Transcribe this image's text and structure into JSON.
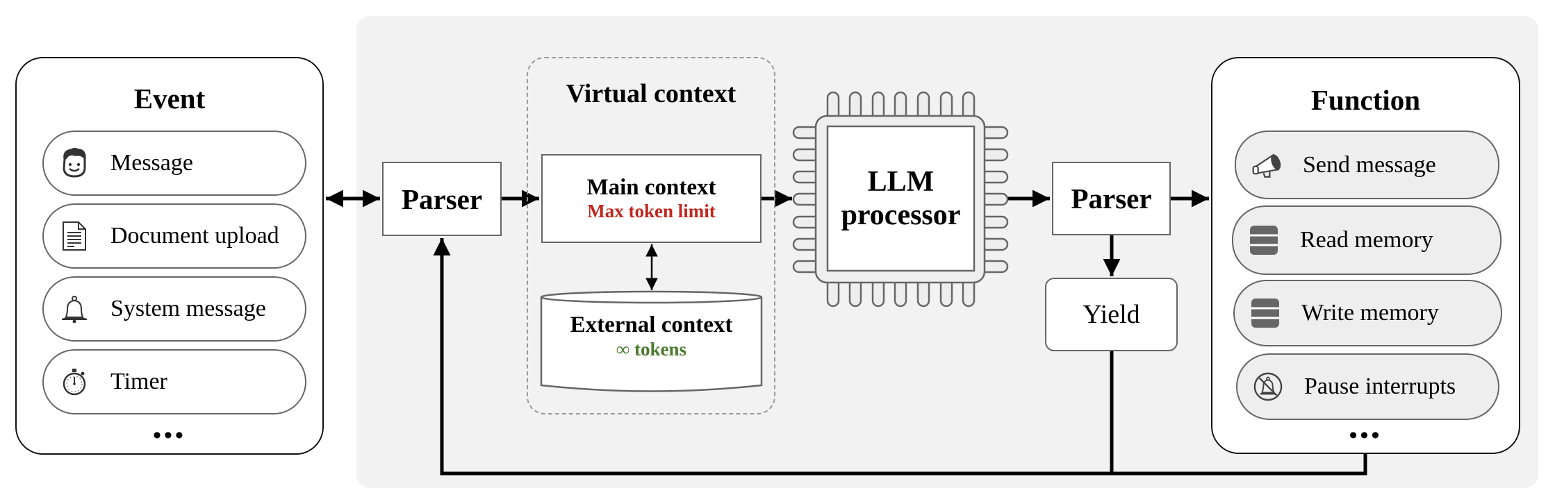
{
  "colors": {
    "background_panel": "#f2f2f2",
    "function_pill_fill": "#eeeeee",
    "max_token_red": "#c0281e",
    "infinite_tokens_green": "#4a7a2c",
    "stroke_gray": "#666666"
  },
  "event_panel": {
    "title": "Event",
    "items": [
      {
        "icon": "face-icon",
        "label": "Message"
      },
      {
        "icon": "document-icon",
        "label": "Document upload"
      },
      {
        "icon": "bell-icon",
        "label": "System message"
      },
      {
        "icon": "stopwatch-icon",
        "label": "Timer"
      }
    ],
    "more": "•••"
  },
  "input_parser": {
    "label": "Parser"
  },
  "virtual_context": {
    "title": "Virtual context",
    "main_context": {
      "title": "Main context",
      "subtitle": "Max token limit"
    },
    "external_context": {
      "title": "External context",
      "subtitle": "∞ tokens"
    }
  },
  "processor": {
    "line1": "LLM",
    "line2": "processor"
  },
  "output_parser": {
    "label": "Parser"
  },
  "yield": {
    "label": "Yield"
  },
  "function_panel": {
    "title": "Function",
    "items": [
      {
        "icon": "megaphone-icon",
        "label": "Send message"
      },
      {
        "icon": "database-icon",
        "label": "Read memory"
      },
      {
        "icon": "database-icon",
        "label": "Write memory"
      },
      {
        "icon": "bell-off-icon",
        "label": "Pause interrupts"
      }
    ],
    "more": "•••"
  }
}
